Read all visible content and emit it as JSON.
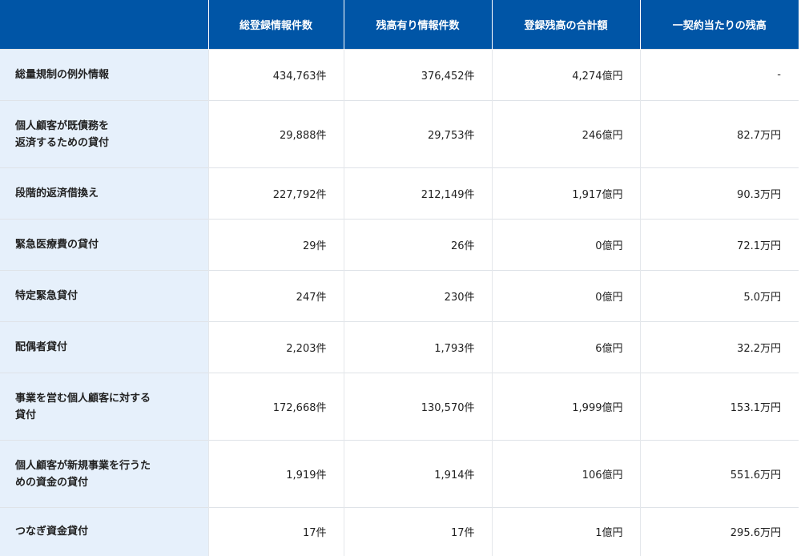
{
  "header": {
    "corner": "",
    "columns": [
      "総登録情報件数",
      "残高有り情報件数",
      "登録残高の合計額",
      "一契約当たりの残高"
    ]
  },
  "rows": [
    {
      "label_lines": [
        "総量規制の例外情報"
      ],
      "values": [
        "434,763件",
        "376,452件",
        "4,274億円",
        "-"
      ]
    },
    {
      "label_lines": [
        "個人顧客が既債務を",
        "返済するための貸付"
      ],
      "values": [
        "29,888件",
        "29,753件",
        "246億円",
        "82.7万円"
      ]
    },
    {
      "label_lines": [
        "段階的返済借換え"
      ],
      "values": [
        "227,792件",
        "212,149件",
        "1,917億円",
        "90.3万円"
      ]
    },
    {
      "label_lines": [
        "緊急医療費の貸付"
      ],
      "values": [
        "29件",
        "26件",
        "0億円",
        "72.1万円"
      ]
    },
    {
      "label_lines": [
        "特定緊急貸付"
      ],
      "values": [
        "247件",
        "230件",
        "0億円",
        "5.0万円"
      ]
    },
    {
      "label_lines": [
        "配偶者貸付"
      ],
      "values": [
        "2,203件",
        "1,793件",
        "6億円",
        "32.2万円"
      ]
    },
    {
      "label_lines": [
        "事業を営む個人顧客に対する",
        "貸付"
      ],
      "values": [
        "172,668件",
        "130,570件",
        "1,999億円",
        "153.1万円"
      ]
    },
    {
      "label_lines": [
        "個人顧客が新規事業を行うた",
        "めの資金の貸付"
      ],
      "values": [
        "1,919件",
        "1,914件",
        "106億円",
        "551.6万円"
      ]
    },
    {
      "label_lines": [
        "つなぎ資金貸付"
      ],
      "values": [
        "17件",
        "17件",
        "1億円",
        "295.6万円"
      ]
    }
  ]
}
